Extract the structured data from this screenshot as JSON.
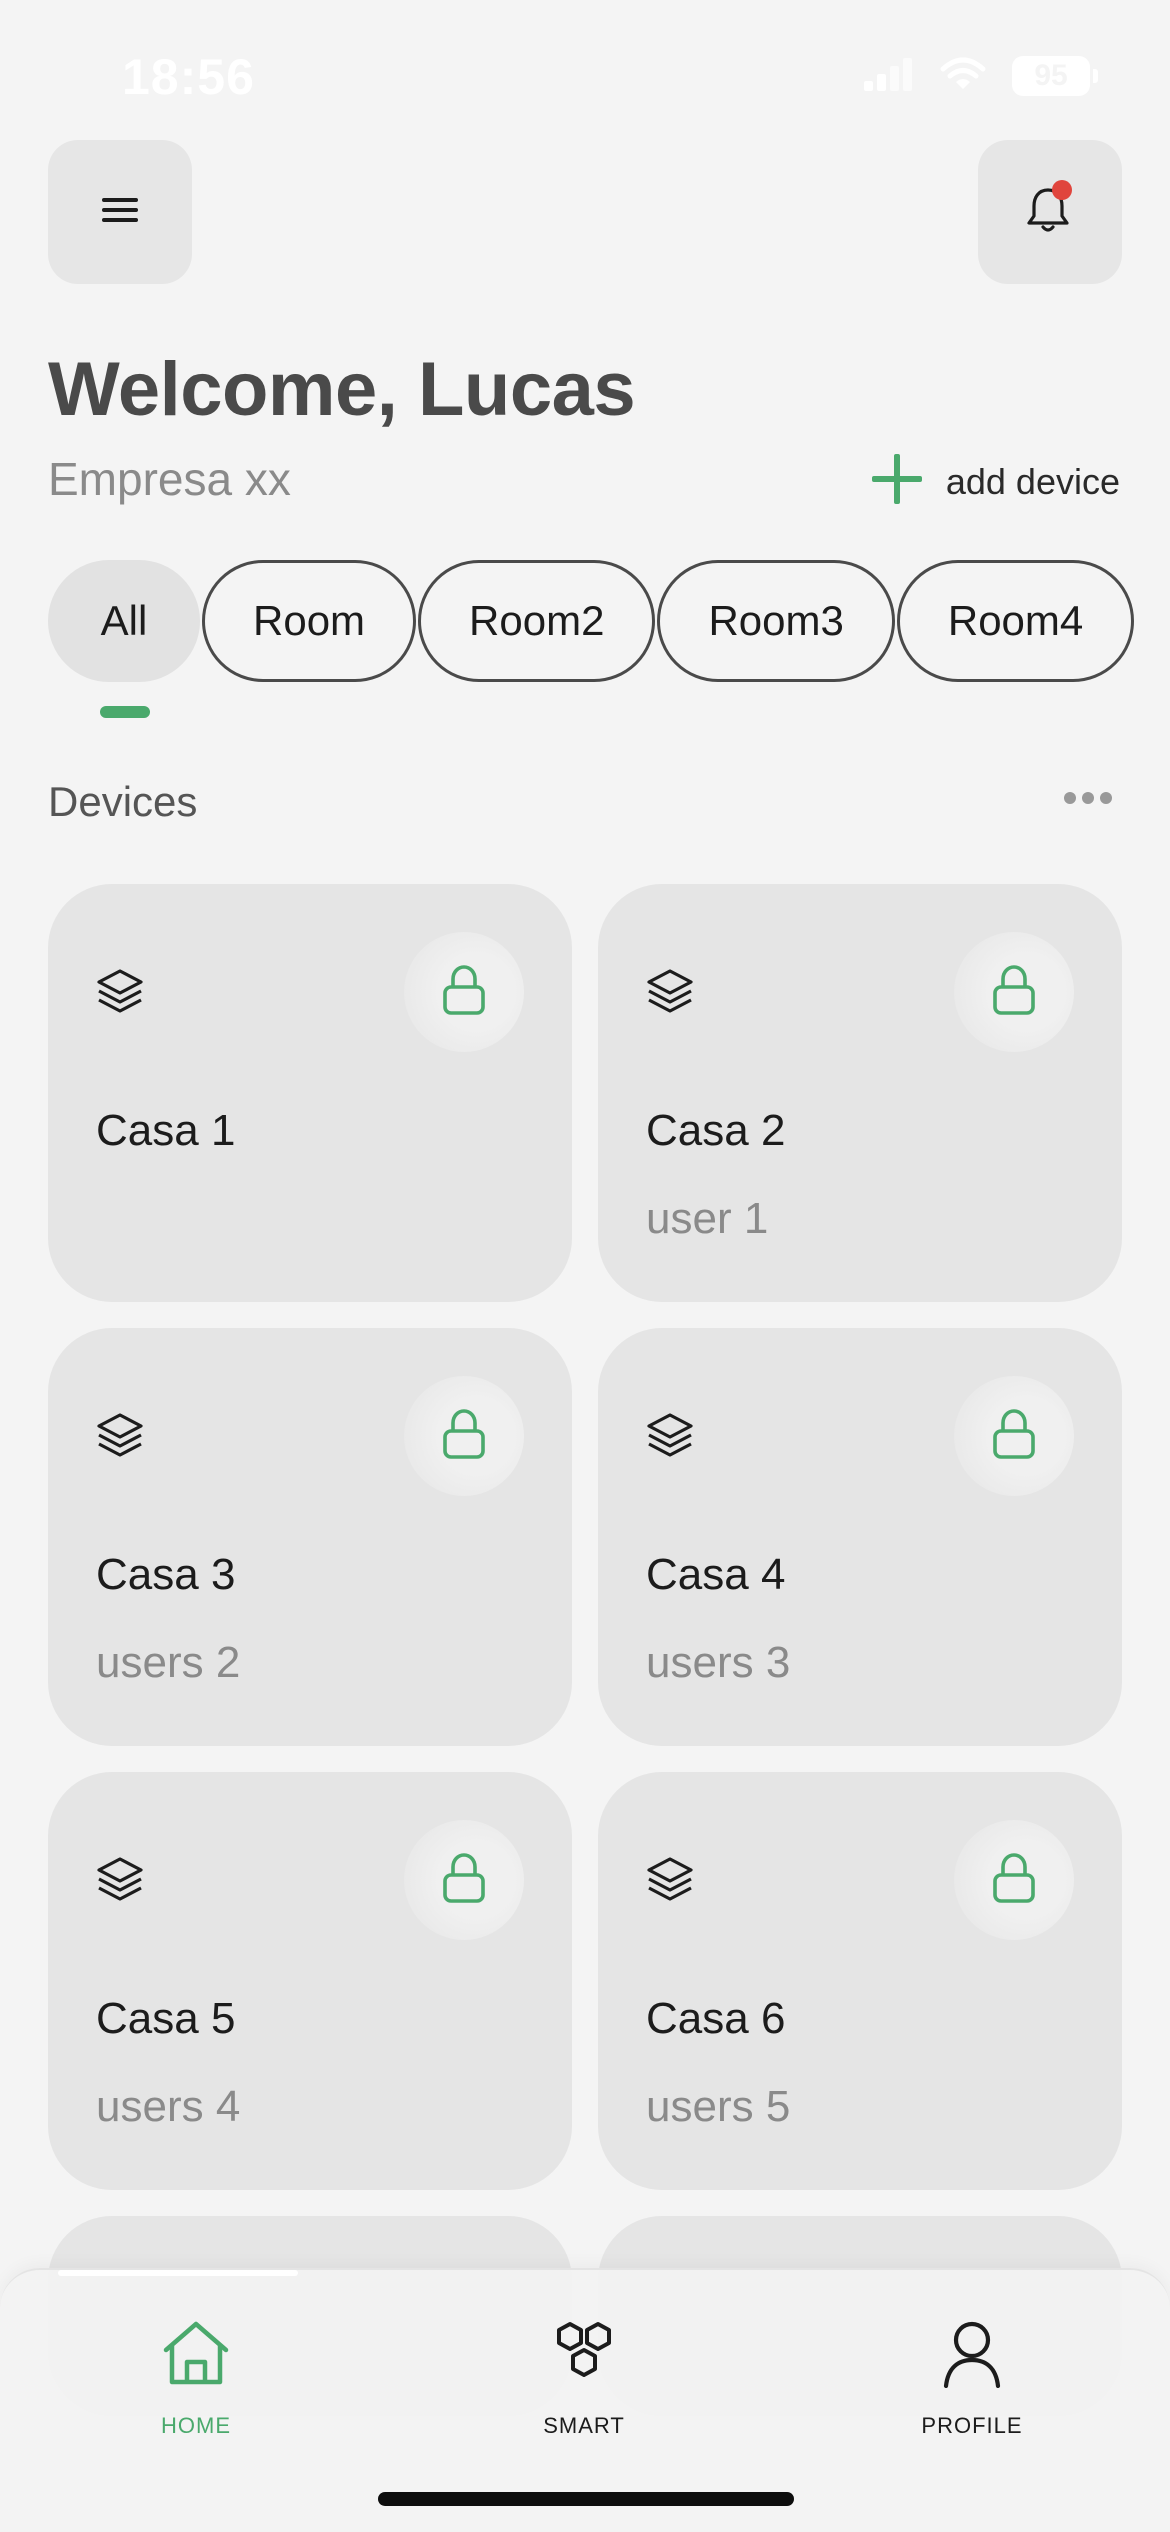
{
  "status_bar": {
    "time": "18:56",
    "battery": "95"
  },
  "header": {
    "menu_icon": "hamburger-menu-icon",
    "bell_icon": "bell-icon",
    "notification_color": "#e0453d",
    "welcome": "Welcome, Lucas",
    "company": "Empresa xx",
    "add_device_label": "add device"
  },
  "tabs": [
    {
      "label": "All",
      "active": true
    },
    {
      "label": "Room"
    },
    {
      "label": "Room2"
    },
    {
      "label": "Room3"
    },
    {
      "label": "Room4"
    }
  ],
  "devices": {
    "title": "Devices",
    "items": [
      {
        "name": "Casa 1",
        "users": ""
      },
      {
        "name": "Casa 2",
        "users": "user 1"
      },
      {
        "name": "Casa 3",
        "users": "users 2"
      },
      {
        "name": "Casa 4",
        "users": "users 3"
      },
      {
        "name": "Casa 5",
        "users": "users 4"
      },
      {
        "name": "Casa 6",
        "users": "users 5"
      }
    ]
  },
  "bottom_nav": {
    "items": [
      {
        "label": "HOME",
        "icon": "home-icon",
        "active": true
      },
      {
        "label": "SMART",
        "icon": "hexagons-icon"
      },
      {
        "label": "PROFILE",
        "icon": "user-icon"
      }
    ]
  },
  "colors": {
    "accent": "#4aa96c",
    "background": "#f4f4f4",
    "card": "#e5e5e5"
  }
}
